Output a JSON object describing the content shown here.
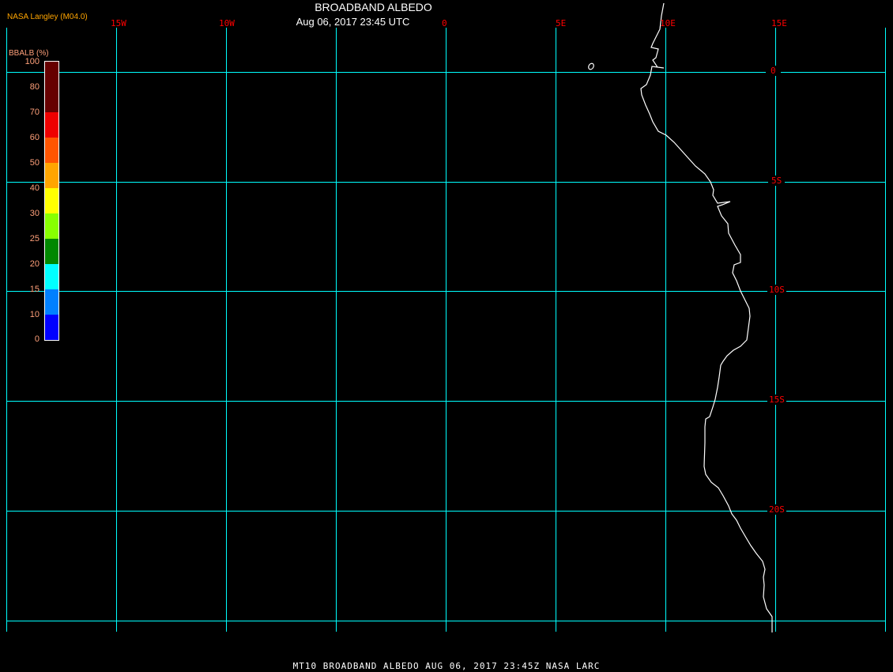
{
  "title": "BROADBAND ALBEDO",
  "subtitle": "Aug 06, 2017 23:45 UTC",
  "credit": "NASA Langley (M04.0)",
  "footer": "MT10  BROADBAND ALBEDO   AUG 06, 2017 23:45Z   NASA LARC",
  "colors": {
    "grid": "#00ffff",
    "coastline": "#ffffff",
    "labels": "#ff0000"
  },
  "longitude_labels": [
    "15W",
    "10W",
    "0",
    "5E",
    "10E",
    "15E"
  ],
  "latitude_labels": [
    "0",
    "5S",
    "10S",
    "15S",
    "20S"
  ],
  "colorbar": {
    "title": "BBALB (%)",
    "ticks": [
      "100",
      "80",
      "70",
      "60",
      "50",
      "40",
      "30",
      "25",
      "20",
      "15",
      "10",
      "0"
    ],
    "colors": [
      "#660000",
      "#660000",
      "#ee0000",
      "#ff5500",
      "#ffa500",
      "#ffff00",
      "#88ff00",
      "#008800",
      "#00ffff",
      "#0080ff",
      "#0000ff",
      "#8a2be2"
    ]
  }
}
